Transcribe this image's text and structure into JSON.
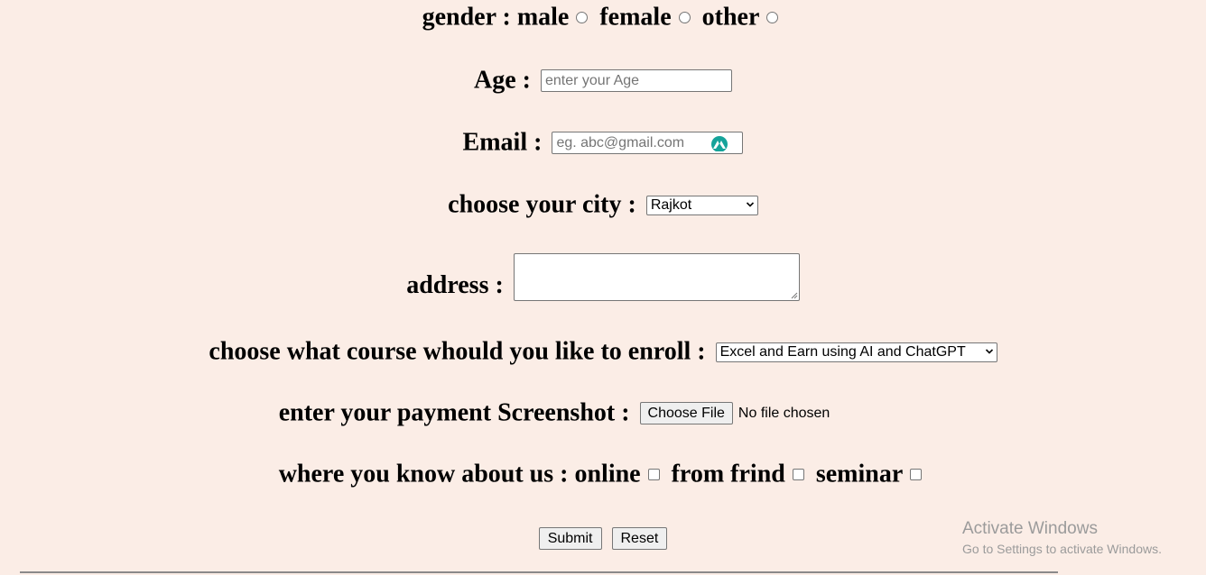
{
  "gender": {
    "label": "gender :",
    "options": [
      "male",
      "female",
      "other"
    ]
  },
  "age": {
    "label": "Age :",
    "placeholder": "enter your Age"
  },
  "email": {
    "label": "Email :",
    "placeholder": "eg. abc@gmail.com",
    "icon": "grammarly-icon",
    "icon_color": "#15a39a"
  },
  "city": {
    "label": "choose your city :",
    "selected": "Rajkot"
  },
  "address": {
    "label": "address :"
  },
  "course": {
    "label": "choose what course whould you like to enroll :",
    "selected": "Excel and Earn using AI and ChatGPT"
  },
  "payment": {
    "label": "enter your payment Screenshot :",
    "button": "Choose File",
    "status": "No file chosen"
  },
  "source": {
    "label": "where you know about us :",
    "options": [
      "online",
      "from frind",
      "seminar"
    ]
  },
  "actions": {
    "submit": "Submit",
    "reset": "Reset"
  },
  "watermark": {
    "title": "Activate Windows",
    "subtitle": "Go to Settings to activate Windows."
  },
  "colors": {
    "background": "#fbede6"
  }
}
